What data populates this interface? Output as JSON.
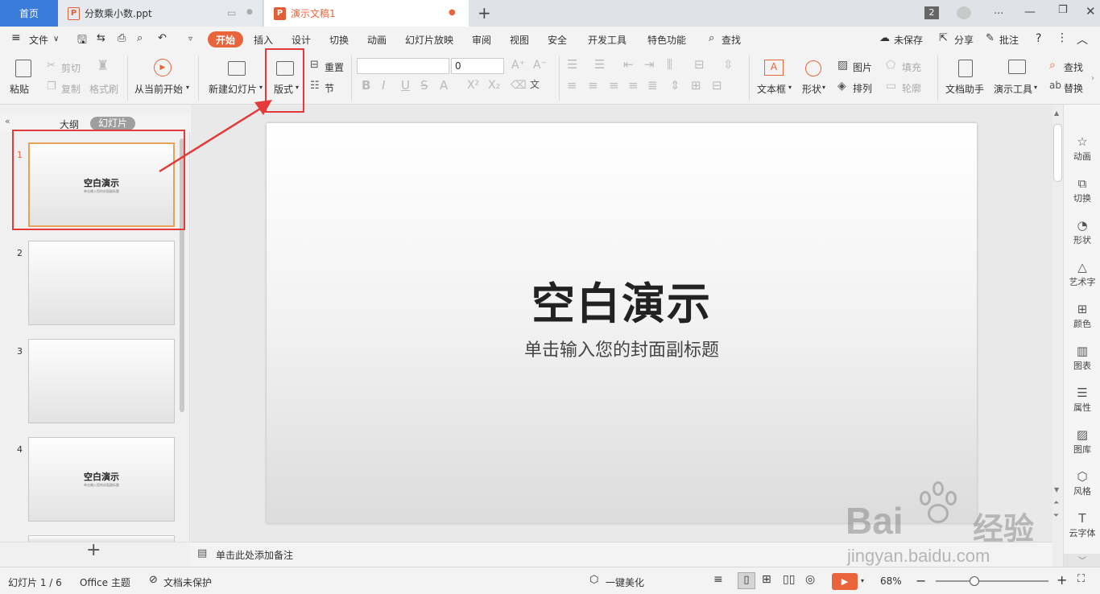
{
  "titlebar": {
    "home_tab": "首页",
    "tabs": [
      {
        "name": "分数乘小数.ppt"
      },
      {
        "name": "演示文稿1"
      }
    ],
    "badge": "2",
    "more": "..."
  },
  "menubar": {
    "file": "文件",
    "items": [
      "开始",
      "插入",
      "设计",
      "切换",
      "动画",
      "幻灯片放映",
      "审阅",
      "视图",
      "安全",
      "开发工具",
      "特色功能"
    ],
    "search": "查找",
    "unsaved": "未保存",
    "share": "分享",
    "comment": "批注",
    "help": "?"
  },
  "ribbon": {
    "paste": "粘贴",
    "cut": "剪切",
    "copy": "复制",
    "format_painter": "格式刷",
    "play_from_current": "从当前开始",
    "new_slide": "新建幻灯片",
    "layout": "版式",
    "reset": "重置",
    "section": "节",
    "font_size": "0",
    "textbox": "文本框",
    "shape": "形状",
    "picture": "图片",
    "arrange": "排列",
    "fill": "填充",
    "outline": "轮廓",
    "doc_assistant": "文档助手",
    "present_tools": "演示工具",
    "find": "查找",
    "replace": "替换"
  },
  "leftpane": {
    "outline_tab": "大纲",
    "slides_tab": "幻灯片",
    "slides": [
      {
        "num": "1",
        "title": "空白演示",
        "subtitle": "单击输入您的封面副标题"
      },
      {
        "num": "2",
        "title": "",
        "subtitle": ""
      },
      {
        "num": "3",
        "title": "",
        "subtitle": ""
      },
      {
        "num": "4",
        "title": "空白演示",
        "subtitle": "单击输入您的封面副标题"
      }
    ]
  },
  "slide": {
    "title": "空白演示",
    "subtitle": "单击输入您的封面副标题"
  },
  "notes": {
    "placeholder": "单击此处添加备注"
  },
  "rightbar": {
    "items": [
      {
        "label": "动画",
        "icon": "animation-icon"
      },
      {
        "label": "切换",
        "icon": "transition-icon"
      },
      {
        "label": "形状",
        "icon": "shape-icon"
      },
      {
        "label": "艺术字",
        "icon": "wordart-icon"
      },
      {
        "label": "颜色",
        "icon": "color-icon"
      },
      {
        "label": "图表",
        "icon": "chart-icon"
      },
      {
        "label": "属性",
        "icon": "property-icon"
      },
      {
        "label": "图库",
        "icon": "gallery-icon"
      },
      {
        "label": "风格",
        "icon": "style-icon"
      },
      {
        "label": "云字体",
        "icon": "cloudfont-icon"
      }
    ]
  },
  "status": {
    "slide_counter": "幻灯片 1 / 6",
    "theme": "Office 主题",
    "protect": "文档未保护",
    "beautify": "一键美化",
    "zoom": "68%",
    "zoom_fraction": 0.68
  },
  "watermark": {
    "brand": "Bai",
    "brand2": "du",
    "cn": "经验",
    "url": "jingyan.baidu.com"
  },
  "colors": {
    "accent": "#e9643a",
    "home_tab": "#3b7bd9",
    "annotation": "#e53a3a"
  }
}
